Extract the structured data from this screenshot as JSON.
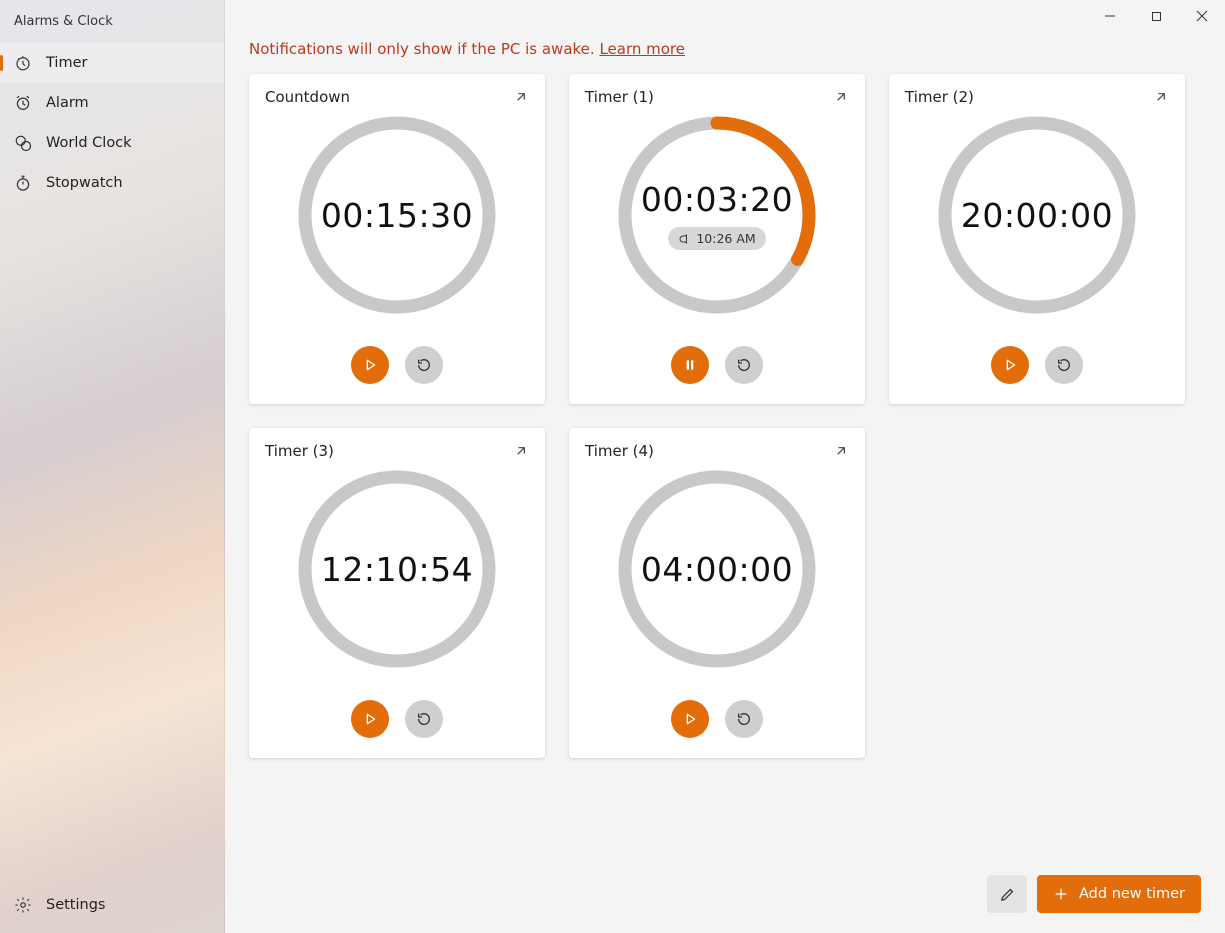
{
  "app_title": "Alarms & Clock",
  "sidebar": {
    "items": [
      {
        "label": "Timer",
        "active": true
      },
      {
        "label": "Alarm",
        "active": false
      },
      {
        "label": "World Clock",
        "active": false
      },
      {
        "label": "Stopwatch",
        "active": false
      }
    ],
    "settings_label": "Settings"
  },
  "notice": {
    "text": "Notifications will only show if the PC is awake. ",
    "link_text": "Learn more"
  },
  "accent_color": "#e36c0b",
  "ring_bg_color": "#c8c8c8",
  "timers": [
    {
      "title": "Countdown",
      "time": "00:15:30",
      "progress": 0,
      "running": false,
      "end_time": null
    },
    {
      "title": "Timer (1)",
      "time": "00:03:20",
      "progress": 0.33,
      "running": true,
      "end_time": "10:26 AM"
    },
    {
      "title": "Timer (2)",
      "time": "20:00:00",
      "progress": 0,
      "running": false,
      "end_time": null
    },
    {
      "title": "Timer (3)",
      "time": "12:10:54",
      "progress": 0,
      "running": false,
      "end_time": null
    },
    {
      "title": "Timer (4)",
      "time": "04:00:00",
      "progress": 0,
      "running": false,
      "end_time": null
    }
  ],
  "bottom_bar": {
    "add_label": "Add new timer"
  }
}
